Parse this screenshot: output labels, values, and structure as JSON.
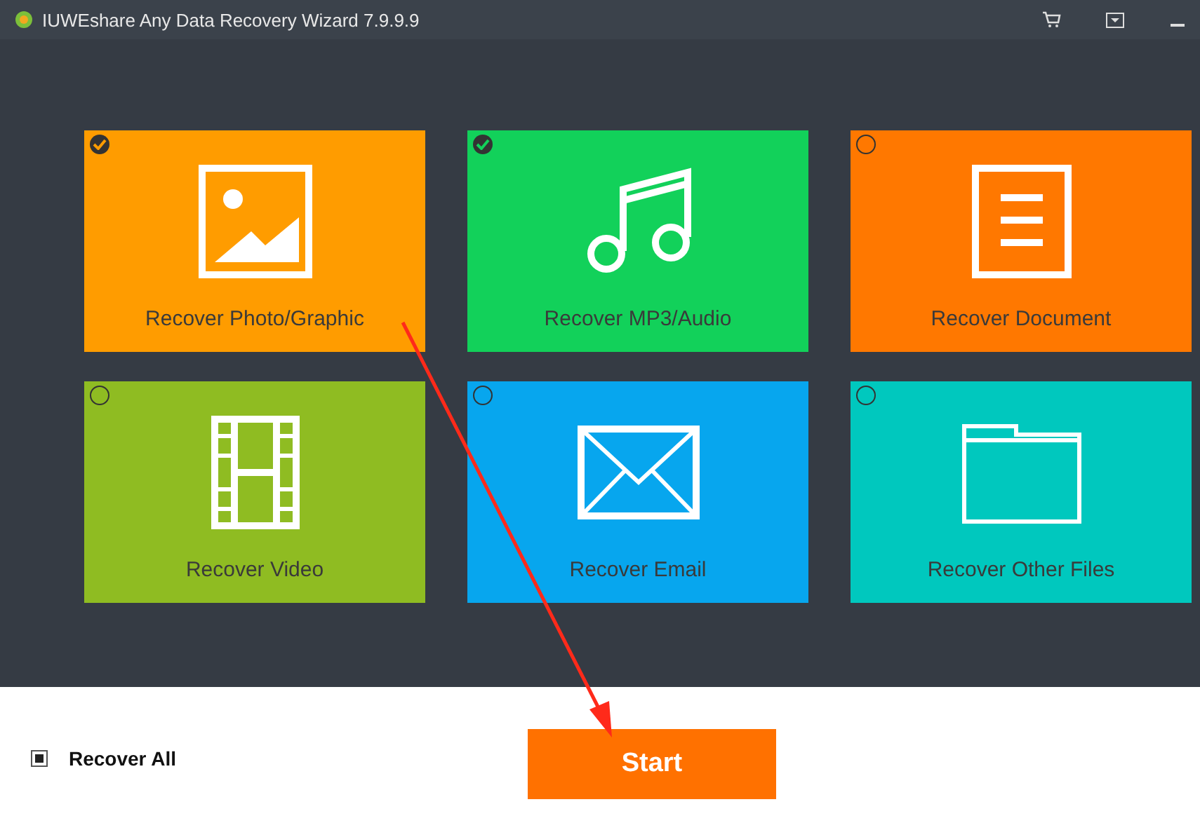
{
  "window": {
    "title": "IUWEshare Any Data Recovery Wizard 7.9.9.9"
  },
  "tiles": [
    {
      "kind": "photo",
      "label": "Recover Photo/Graphic",
      "selected": true,
      "color": "#ff9c00"
    },
    {
      "kind": "audio",
      "label": "Recover MP3/Audio",
      "selected": true,
      "color": "#12d15a"
    },
    {
      "kind": "document",
      "label": "Recover Document",
      "selected": false,
      "color": "#ff7800"
    },
    {
      "kind": "video",
      "label": "Recover Video",
      "selected": false,
      "color": "#8fbc22"
    },
    {
      "kind": "email",
      "label": "Recover Email",
      "selected": false,
      "color": "#07a6ee"
    },
    {
      "kind": "folder",
      "label": "Recover Other Files",
      "selected": false,
      "color": "#00c8be"
    }
  ],
  "recover_all": {
    "label": "Recover All",
    "checked": true
  },
  "start_button": {
    "label": "Start"
  }
}
